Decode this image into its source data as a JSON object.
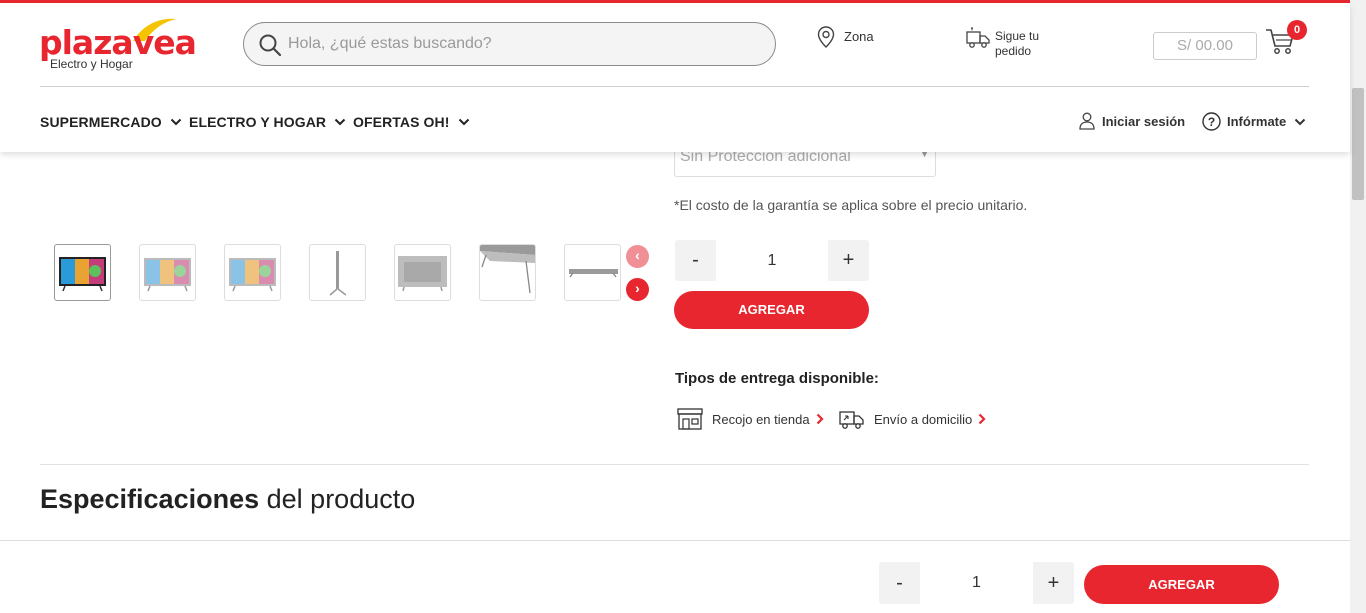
{
  "brand": {
    "logo_word": "plaza",
    "logo_word2": "vea",
    "logo_sub": "Electro y Hogar",
    "accent": "#e8262f"
  },
  "search": {
    "placeholder": "Hola, ¿qué estas buscando?"
  },
  "header": {
    "zona_label": "Zona",
    "sigue_label": "Sigue tu pedido",
    "cart_total": "S/ 00.00",
    "cart_count": "0"
  },
  "nav": {
    "items": [
      {
        "label": "SUPERMERCADO"
      },
      {
        "label": "ELECTRO Y HOGAR"
      },
      {
        "label": "OFERTAS OH!"
      }
    ],
    "login_label": "Iniciar sesión",
    "informate_label": "Infórmate"
  },
  "product": {
    "warranty_select": "Sin Proteccion adicional",
    "warranty_note": "*El costo de la garantía se aplica sobre el precio unitario.",
    "quantity": "1",
    "minus": "-",
    "plus": "+",
    "add_label": "AGREGAR",
    "delivery_title": "Tipos de entrega disponible:",
    "delivery_options": [
      {
        "label": "Recojo en tienda"
      },
      {
        "label": "Envío a domicilio"
      }
    ],
    "thumbnails": [
      "tv-front-colorful",
      "tv-front-colorful-2",
      "tv-front-colorful-3",
      "tv-side",
      "tv-back",
      "tv-angle",
      "tv-top"
    ]
  },
  "specs": {
    "title_bold": "Especificaciones",
    "title_rest": "del producto"
  },
  "sticky": {
    "quantity": "1",
    "minus": "-",
    "plus": "+",
    "add_label": "AGREGAR"
  }
}
